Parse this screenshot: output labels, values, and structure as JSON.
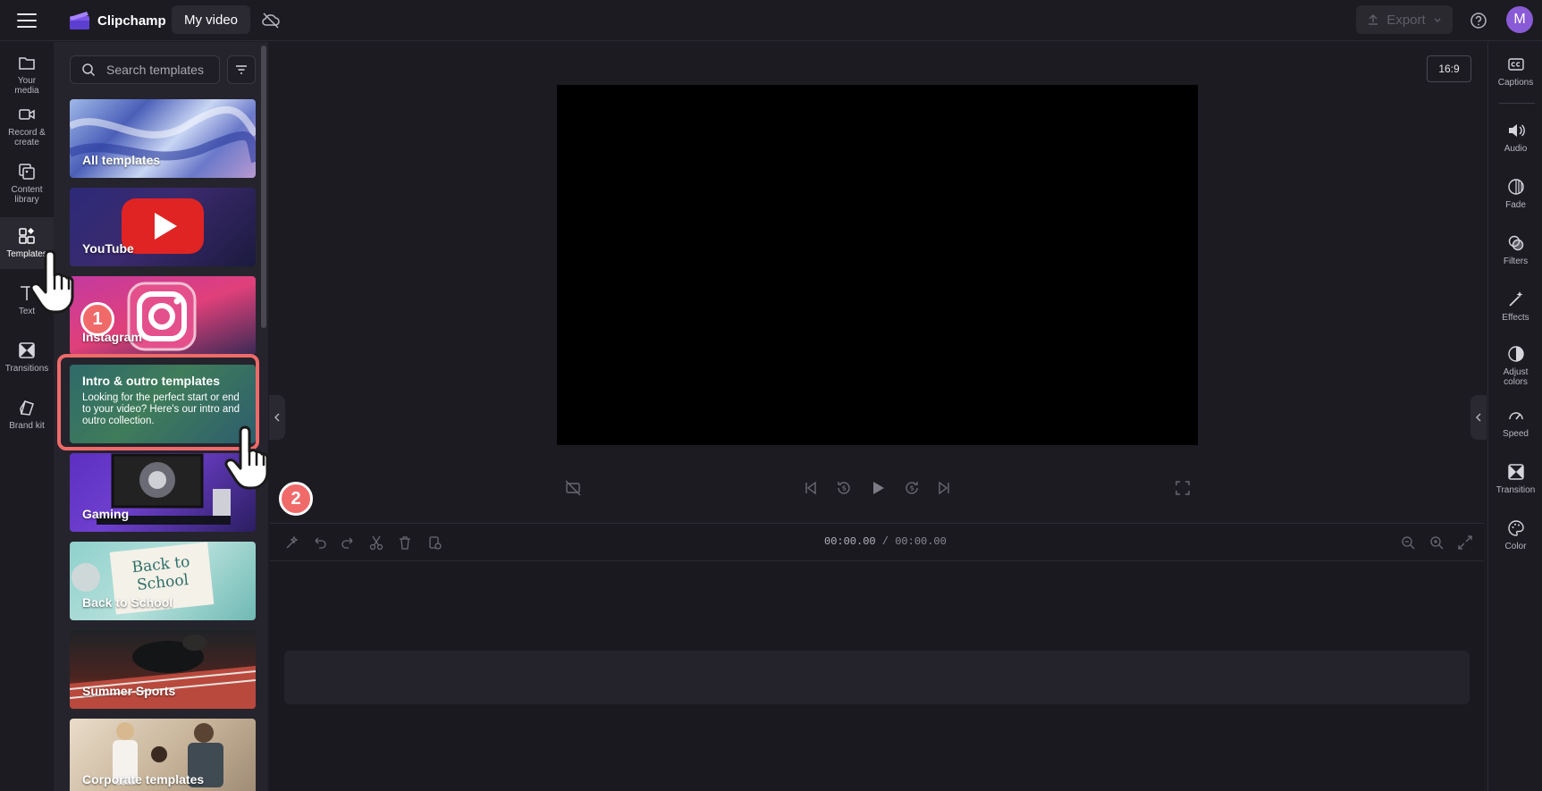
{
  "app": {
    "name": "Clipchamp",
    "project_title": "My video",
    "avatar_initial": "M",
    "accent": "#8a5bd6"
  },
  "topbar": {
    "export_label": "Export"
  },
  "leftnav": {
    "items": [
      {
        "label_line1": "Your",
        "label_line2": "media",
        "icon": "folder-icon"
      },
      {
        "label_line1": "Record &",
        "label_line2": "create",
        "icon": "camera-icon"
      },
      {
        "label_line1": "Content",
        "label_line2": "library",
        "icon": "library-icon"
      },
      {
        "label_line1": "Templates",
        "label_line2": "",
        "icon": "templates-icon"
      },
      {
        "label_line1": "Text",
        "label_line2": "",
        "icon": "text-icon"
      },
      {
        "label_line1": "Transitions",
        "label_line2": "",
        "icon": "transitions-icon"
      },
      {
        "label_line1": "Brand kit",
        "label_line2": "",
        "icon": "brand-kit-icon"
      }
    ]
  },
  "panel": {
    "search_placeholder": "Search templates",
    "cards": [
      {
        "label": "All templates"
      },
      {
        "label": "YouTube"
      },
      {
        "label": "Instagram"
      },
      {
        "label": "Intro & outro templates",
        "description": "Looking for the perfect start or end to your video? Here's our intro and outro collection."
      },
      {
        "label": "Gaming"
      },
      {
        "label": "Back to School"
      },
      {
        "label": "Summer Sports"
      },
      {
        "label": "Corporate templates"
      }
    ],
    "school_art_text": "Back to School"
  },
  "preview": {
    "aspect_ratio": "16:9"
  },
  "timeline": {
    "current_time": "00:00.00",
    "separator": " / ",
    "total_time": "00:00.00"
  },
  "rightrail": {
    "items": [
      {
        "label_line1": "Captions",
        "label_line2": "",
        "icon": "captions-icon"
      },
      {
        "label_line1": "Audio",
        "label_line2": "",
        "icon": "audio-icon"
      },
      {
        "label_line1": "Fade",
        "label_line2": "",
        "icon": "fade-icon"
      },
      {
        "label_line1": "Filters",
        "label_line2": "",
        "icon": "filters-icon"
      },
      {
        "label_line1": "Effects",
        "label_line2": "",
        "icon": "effects-icon"
      },
      {
        "label_line1": "Adjust",
        "label_line2": "colors",
        "icon": "adjust-colors-icon"
      },
      {
        "label_line1": "Speed",
        "label_line2": "",
        "icon": "speed-icon"
      },
      {
        "label_line1": "Transition",
        "label_line2": "",
        "icon": "transition-icon"
      },
      {
        "label_line1": "Color",
        "label_line2": "",
        "icon": "color-palette-icon"
      }
    ]
  },
  "annotations": {
    "step1": "1",
    "step2": "2"
  }
}
